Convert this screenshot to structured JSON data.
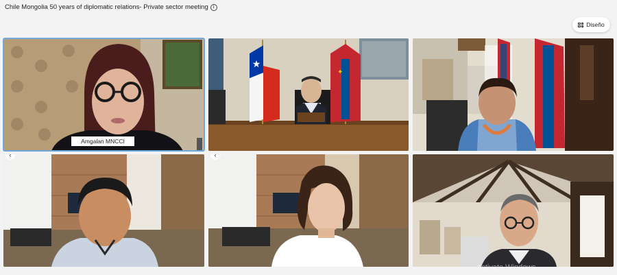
{
  "meeting": {
    "title": "Chile Mongolia 50 years of diplomatic relations- Private sector meeting",
    "info_icon": "i"
  },
  "toolbar": {
    "layout_label": "Diseño",
    "layout_icon": "grid-icon"
  },
  "participants": [
    {
      "name": "Amgalan MNCCI",
      "speaking": true
    },
    {
      "name": ""
    },
    {
      "name": ""
    },
    {
      "name": ""
    },
    {
      "name": ""
    },
    {
      "name": ""
    }
  ],
  "overlay": {
    "watermark": "Activate Windows"
  },
  "colors": {
    "active_outline": "#6fa8dc",
    "chile_red": "#d52b1e",
    "chile_blue": "#0039a6",
    "mongolia_red": "#c4272f",
    "mongolia_blue": "#015197"
  }
}
